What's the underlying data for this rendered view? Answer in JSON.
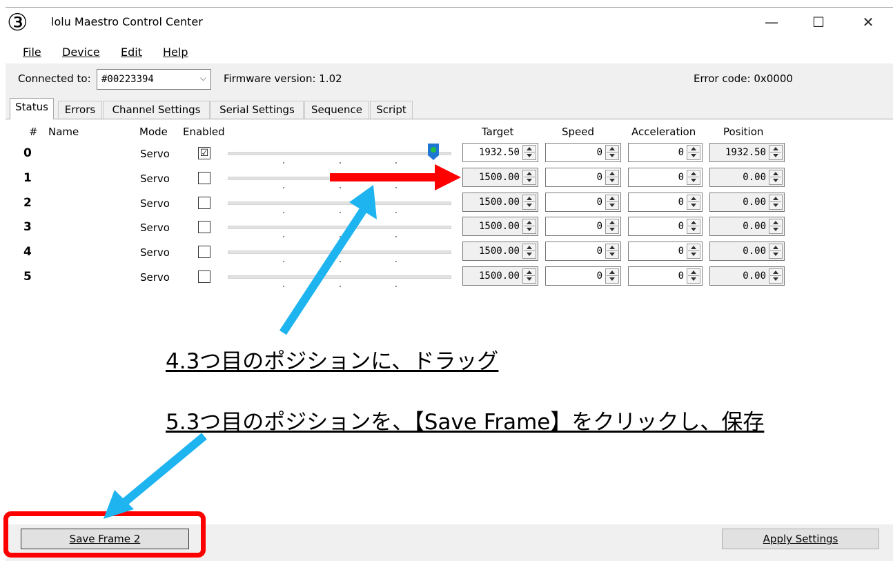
{
  "badge": "③",
  "window": {
    "title": "lolu Maestro Control Center"
  },
  "controls": {
    "minimize": "—",
    "maximize": "☐",
    "close": "✕"
  },
  "menu": [
    "File",
    "Device",
    "Edit",
    "Help"
  ],
  "connection": {
    "label": "Connected to:",
    "device": "#00223394",
    "firmware": "Firmware version: 1.02",
    "error": "Error code:  0x0000"
  },
  "tabs": [
    "Status",
    "Errors",
    "Channel Settings",
    "Serial Settings",
    "Sequence",
    "Script"
  ],
  "headers": {
    "num": "#",
    "name": "Name",
    "mode": "Mode",
    "enabled": "Enabled",
    "target": "Target",
    "speed": "Speed",
    "acceleration": "Acceleration",
    "position": "Position"
  },
  "channels": [
    {
      "num": "0",
      "mode": "Servo",
      "enabled": true,
      "check": "☑",
      "target": "1932.50",
      "speed": "0",
      "acceleration": "0",
      "position": "1932.50"
    },
    {
      "num": "1",
      "mode": "Servo",
      "enabled": false,
      "check": "",
      "target": "1500.00",
      "speed": "0",
      "acceleration": "0",
      "position": "0.00"
    },
    {
      "num": "2",
      "mode": "Servo",
      "enabled": false,
      "check": "",
      "target": "1500.00",
      "speed": "0",
      "acceleration": "0",
      "position": "0.00"
    },
    {
      "num": "3",
      "mode": "Servo",
      "enabled": false,
      "check": "",
      "target": "1500.00",
      "speed": "0",
      "acceleration": "0",
      "position": "0.00"
    },
    {
      "num": "4",
      "mode": "Servo",
      "enabled": false,
      "check": "",
      "target": "1500.00",
      "speed": "0",
      "acceleration": "0",
      "position": "0.00"
    },
    {
      "num": "5",
      "mode": "Servo",
      "enabled": false,
      "check": "",
      "target": "1500.00",
      "speed": "0",
      "acceleration": "0",
      "position": "0.00"
    }
  ],
  "slider0_level": 0.92,
  "buttons": {
    "save_frame": "Save Frame 2",
    "apply": "Apply Settings"
  },
  "annotations": {
    "step4": "4.3つ目のポジションに、ドラッグ",
    "step5": "5.3つ目のポジションを、【Save Frame】をクリックし、保存"
  },
  "colors": {
    "red_arrow": "#ff0000",
    "blue_arrow": "#1eb4f0",
    "thumb": "#1e78d2",
    "thumb_dot": "#22c040"
  }
}
